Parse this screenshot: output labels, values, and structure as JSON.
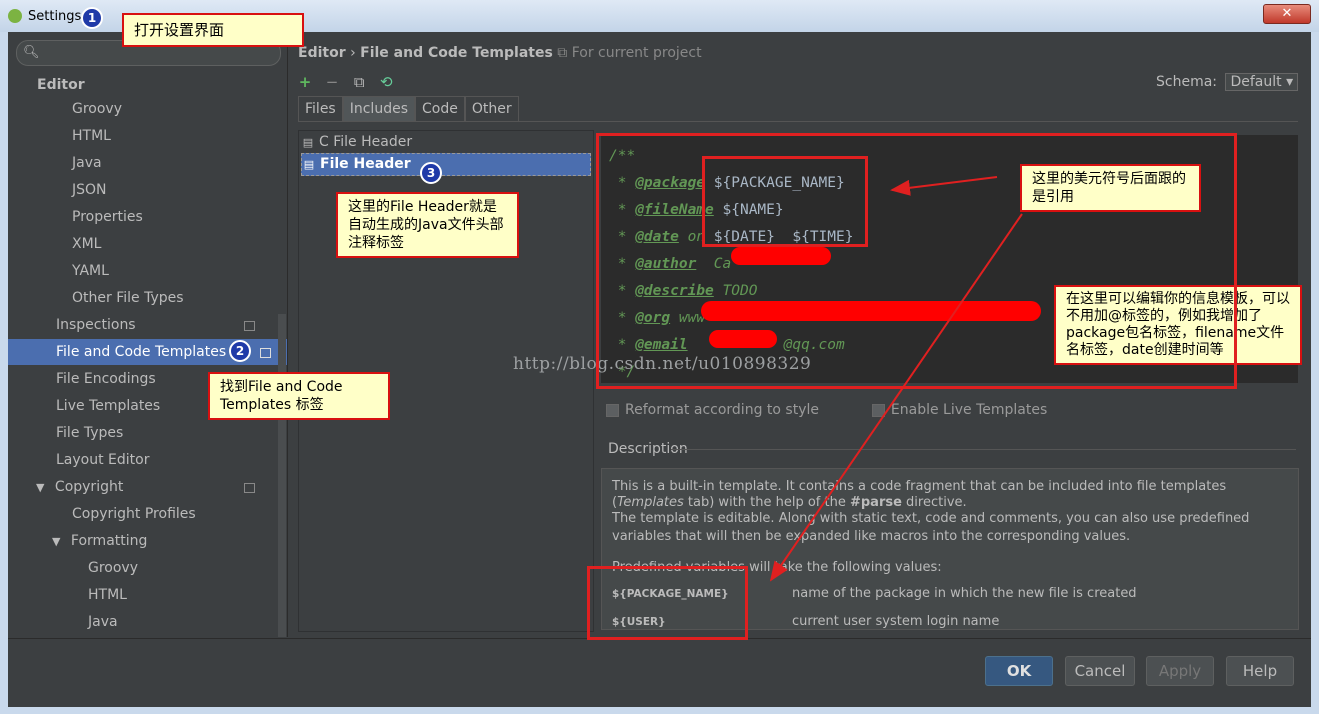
{
  "window": {
    "title": "Settings",
    "close": "✕"
  },
  "search": {
    "icon": "search-icon",
    "placeholder": ""
  },
  "sidebar": {
    "items": [
      {
        "label": "Editor"
      },
      {
        "label": "Groovy"
      },
      {
        "label": "HTML"
      },
      {
        "label": "Java"
      },
      {
        "label": "JSON"
      },
      {
        "label": "Properties"
      },
      {
        "label": "XML"
      },
      {
        "label": "YAML"
      },
      {
        "label": "Other File Types"
      },
      {
        "label": "Inspections"
      },
      {
        "label": "File and Code Templates"
      },
      {
        "label": "File Encodings"
      },
      {
        "label": "Live Templates"
      },
      {
        "label": "File Types"
      },
      {
        "label": "Layout Editor"
      },
      {
        "label": "Copyright"
      },
      {
        "label": "Copyright Profiles"
      },
      {
        "label": "Formatting"
      },
      {
        "label": "Groovy"
      },
      {
        "label": "HTML"
      },
      {
        "label": "Java"
      }
    ]
  },
  "breadcrumb": {
    "part1": "Editor",
    "sep": "›",
    "part2": "File and Code Templates",
    "project": "For current project"
  },
  "schema": {
    "label": "Schema:",
    "value": "Default"
  },
  "tabs": [
    "Files",
    "Includes",
    "Code",
    "Other"
  ],
  "templates": [
    "C File Header",
    "File Header"
  ],
  "code": {
    "l1": "/**",
    "l2a": " * ",
    "l2tag": "@package",
    "l2var": " ${PACKAGE_NAME}",
    "l3tag": "@fileName",
    "l3var": " ${NAME}",
    "l4tag": "@date",
    "l4mid": " on",
    "l4var": " ${DATE}  ${TIME}",
    "l5tag": "@author",
    "l5rest": "  Ca",
    "l6tag": "@describe",
    "l6rest": " TODO",
    "l7tag": "@org",
    "l7rest": " www",
    "l8tag": "@email",
    "l8rest": "@qq.com",
    "l9": " */"
  },
  "watermark": "http://blog.csdn.net/u010898329",
  "options": {
    "reformat": "Reformat according to style",
    "live": "Enable Live Templates"
  },
  "description": {
    "label": "Description",
    "p1": "This is a built-in template. It contains a code fragment that can be included into file templates",
    "p2a": "(",
    "p2i": "Templates",
    "p2b": " tab) with the help of the ",
    "p2c": "#parse",
    "p2d": " directive.",
    "p3": "The template is editable. Along with static text, code and comments, you can also use predefined",
    "p4": "variables that will then be expanded like macros into the corresponding values.",
    "p5": "Predefined variables will take the following values:",
    "v1": "${PACKAGE_NAME}",
    "v1d": "name of the package in which the new file is created",
    "v2": "${USER}",
    "v2d": "current user system login name"
  },
  "buttons": {
    "ok": "OK",
    "cancel": "Cancel",
    "apply": "Apply",
    "help": "Help"
  },
  "annotations": {
    "a1": "打开设置界面",
    "a2": "找到File and Code Templates 标签",
    "a3": "这里的File Header就是自动生成的Java文件头部注释标签",
    "a4": "这里的美元符号后面跟的是引用",
    "a5": "在这里可以编辑你的信息模板，可以不用加@标签的，例如我增加了package包名标签，filename文件名标签，date创建时间等",
    "n1": "1",
    "n2": "2",
    "n3": "3"
  },
  "colors": {
    "accent": "#4b6eaf",
    "annotation_border": "#e02020",
    "annotation_bg": "#ffffc8"
  }
}
